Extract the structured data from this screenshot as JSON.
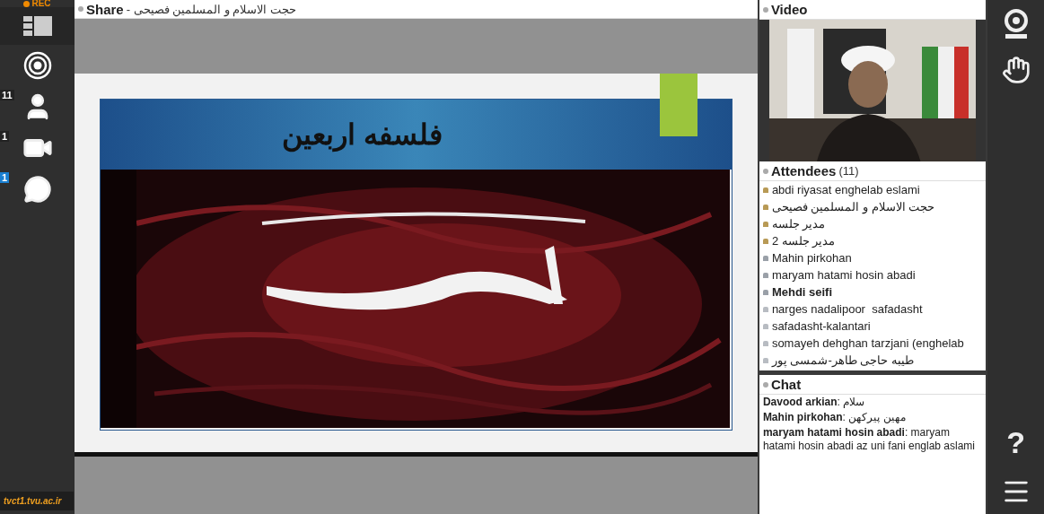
{
  "recording": {
    "label": "REC",
    "on": true
  },
  "left_toolbar": [
    {
      "kind": "layout"
    },
    {
      "kind": "broadcast"
    },
    {
      "kind": "attendees",
      "badge": "11"
    },
    {
      "kind": "camera",
      "badge": "1"
    },
    {
      "kind": "chat",
      "badge": "1",
      "highlight": true
    }
  ],
  "site_label": "tvct1.tvu.ac.ir",
  "share": {
    "title": "Share",
    "subtitle": "- حجت الاسلام و المسلمین فصیحی",
    "slide_title": "فلسفه اربعین"
  },
  "video": {
    "title": "Video"
  },
  "attendees": {
    "title": "Attendees",
    "count": "(11)",
    "items": [
      {
        "name": "abdi riyasat enghelab eslami",
        "kind": "host",
        "is_me": false
      },
      {
        "name": "حجت الاسلام و المسلمین فصیحی",
        "kind": "host",
        "is_me": false
      },
      {
        "name": "مدیر جلسه",
        "kind": "host",
        "is_me": false
      },
      {
        "name": "مدیر جلسه 2",
        "kind": "host",
        "is_me": false
      },
      {
        "name": "Mahin pirkohan",
        "kind": "presenter",
        "is_me": false
      },
      {
        "name": "maryam hatami hosin abadi",
        "kind": "presenter",
        "is_me": false
      },
      {
        "name": "Mehdi seifi",
        "kind": "presenter",
        "is_me": true
      },
      {
        "name": "narges nadalipoor  safadasht",
        "kind": "participant",
        "is_me": false
      },
      {
        "name": "safadasht-kalantari",
        "kind": "participant",
        "is_me": false
      },
      {
        "name": "somayeh dehghan tarzjani (enghelab",
        "kind": "participant",
        "is_me": false
      },
      {
        "name": "طیبه حاجی طاهر-شمسی پور",
        "kind": "participant",
        "is_me": false
      }
    ]
  },
  "chat": {
    "title": "Chat",
    "messages": [
      {
        "text": "**Davood arkian**: سلام"
      },
      {
        "text": "**Mahin pirkohan**: مهین پیرکهن"
      },
      {
        "text": "**maryam hatami hosin abadi**: maryam hatami hosin abadi az uni fani englab aslami"
      }
    ]
  },
  "right_toolbar": [
    {
      "kind": "webcam"
    },
    {
      "kind": "hand"
    },
    {
      "kind": "help",
      "label": "?"
    },
    {
      "kind": "menu"
    }
  ]
}
